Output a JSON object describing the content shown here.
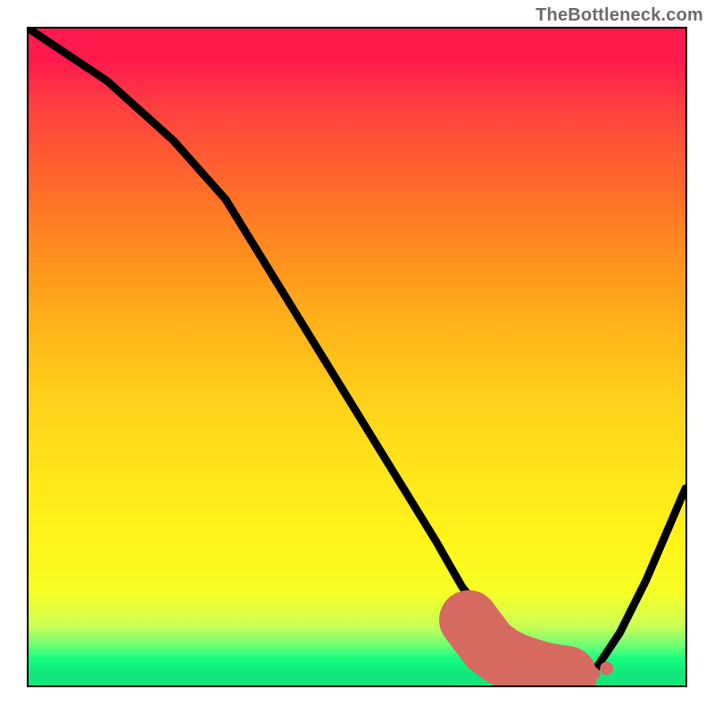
{
  "watermark": "TheBottleneck.com",
  "colors": {
    "curve": "#000000",
    "highlight": "#d66a61"
  },
  "chart_data": {
    "type": "line",
    "title": "",
    "xlabel": "",
    "ylabel": "",
    "xlim": [
      0,
      100
    ],
    "ylim": [
      0,
      100
    ],
    "grid": false,
    "legend": false,
    "series": [
      {
        "name": "curve",
        "x": [
          0,
          12,
          22,
          30,
          38,
          46,
          54,
          62,
          66,
          70,
          74,
          78,
          80,
          82,
          86,
          90,
          94,
          100
        ],
        "y": [
          100,
          92,
          83,
          74,
          61,
          48,
          35,
          22,
          15,
          10,
          6,
          3,
          2,
          1.5,
          2,
          8,
          16,
          30
        ]
      }
    ],
    "highlight_segment": {
      "name": "optimal-range",
      "x": [
        67,
        70,
        72,
        74,
        76,
        78,
        80,
        82
      ],
      "y": [
        10,
        6,
        4.5,
        3.5,
        2.8,
        2.2,
        1.8,
        1.5
      ]
    },
    "highlight_points": [
      {
        "x": 84,
        "y": 1.6
      },
      {
        "x": 86,
        "y": 1.8
      },
      {
        "x": 88,
        "y": 2.6
      }
    ]
  }
}
